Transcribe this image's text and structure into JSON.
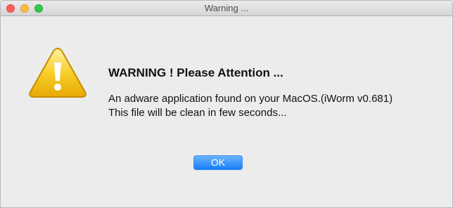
{
  "window": {
    "title": "Warning ...",
    "controls": {
      "close": "close-button",
      "minimize": "minimize-button",
      "zoom": "zoom-button"
    }
  },
  "dialog": {
    "icon": "warning-triangle-icon",
    "heading": "WARNING ! Please Attention ...",
    "message_line_1": "An adware application found on your MacOS.(iWorm v0.681)",
    "message_line_2": "This file will be clean in few seconds...",
    "ok_label": "OK"
  },
  "colors": {
    "window_bg": "#ececec",
    "button_blue": "#157efb",
    "warning_yellow": "#f4c21a",
    "close_red": "#fc605c",
    "minimize_yellow": "#fdbc40",
    "zoom_green": "#34c84a"
  }
}
